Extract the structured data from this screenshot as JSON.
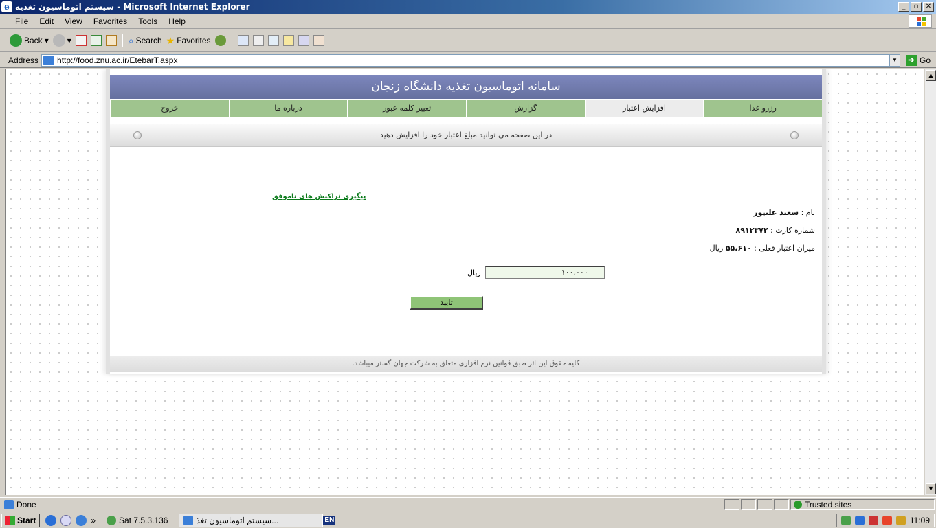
{
  "window": {
    "title": "سیستم اتوماسیون تغذیه - Microsoft Internet Explorer",
    "buttons": [
      "_",
      "▫",
      "✕"
    ]
  },
  "menu": [
    "File",
    "Edit",
    "View",
    "Favorites",
    "Tools",
    "Help"
  ],
  "toolbar": {
    "back": "Back",
    "search": "Search",
    "favorites": "Favorites"
  },
  "address": {
    "label": "Address",
    "url": "http://food.znu.ac.ir/EtebarT.aspx",
    "go": "Go"
  },
  "site": {
    "header": "سامانه اتوماسیون تغذیه دانشگاه زنجان",
    "nav": [
      {
        "label": "رزرو غذا",
        "active": false
      },
      {
        "label": "افزایش اعتبار",
        "active": true
      },
      {
        "label": "گزارش",
        "active": false
      },
      {
        "label": "تغییر کلمه عبور",
        "active": false
      },
      {
        "label": "درباره ما",
        "active": false
      },
      {
        "label": "خروج",
        "active": false
      }
    ],
    "info": "در این صفحه می توانید مبلغ اعتبار خود را افزایش دهید",
    "follow_link": "پیگیری تراکنش های ناموفق",
    "name_label": "نام :",
    "name_value": "سعید علیپور",
    "card_label": "شماره کارت :",
    "card_value": "۸۹۱۲۳۷۲",
    "credit_label": "میزان اعتبار فعلی :",
    "credit_value": "۵۵،۶۱۰",
    "credit_unit": "ریال",
    "amount_value": "۱۰۰،۰۰۰",
    "amount_unit": "ریال",
    "confirm": "تایید",
    "footer": "کلیه حقوق این اثر طبق قوانین نرم افزاری متعلق به شرکت جهان گستر میباشد."
  },
  "status": {
    "text": "Done",
    "zone": "Trusted sites"
  },
  "taskbar": {
    "start": "Start",
    "chevron": "»",
    "sat": "Sat 7.5.3.136",
    "app": "...سیستم اتوماسیون تغذ",
    "lang": "EN",
    "time": "11:09"
  }
}
